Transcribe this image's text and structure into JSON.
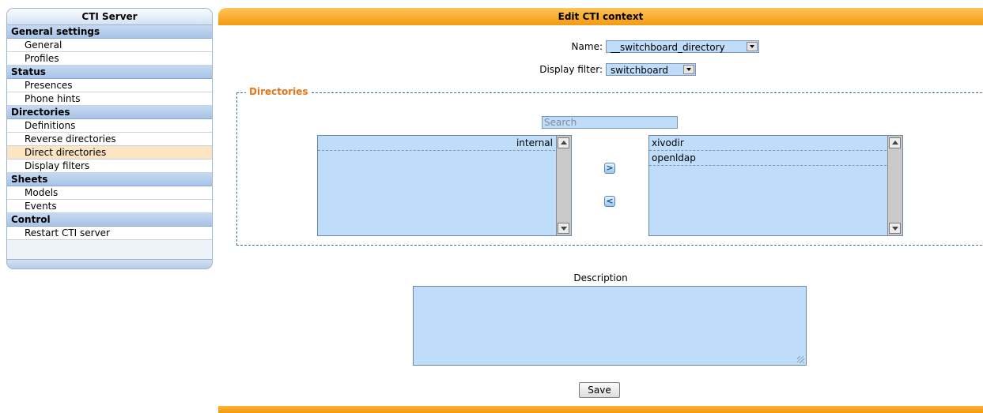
{
  "sidebar": {
    "title": "CTI Server",
    "sections": [
      {
        "title": "General settings",
        "items": [
          "General",
          "Profiles"
        ]
      },
      {
        "title": "Status",
        "items": [
          "Presences",
          "Phone hints"
        ]
      },
      {
        "title": "Directories",
        "items": [
          "Definitions",
          "Reverse directories",
          "Direct directories",
          "Display filters"
        ]
      },
      {
        "title": "Sheets",
        "items": [
          "Models",
          "Events"
        ]
      },
      {
        "title": "Control",
        "items": [
          "Restart CTI server"
        ]
      }
    ],
    "active_item": "Direct directories"
  },
  "main": {
    "title": "Edit CTI context",
    "name_label": "Name:",
    "name_value": "__switchboard_directory",
    "display_filter_label": "Display filter:",
    "display_filter_value": "switchboard",
    "directories_legend": "Directories",
    "search_placeholder": "Search",
    "available_list": [
      "internal"
    ],
    "selected_list": [
      "xivodir",
      "openldap"
    ],
    "move_right_symbol": ">",
    "move_left_symbol": "<",
    "description_label": "Description",
    "description_value": "",
    "save_label": "Save"
  },
  "colors": {
    "accent_orange": "#f39a10",
    "legend_orange": "#e8741a",
    "field_blue": "#bfdcf8",
    "sidebar_section": "#a8c4e8",
    "active_item": "#fde4c3"
  }
}
